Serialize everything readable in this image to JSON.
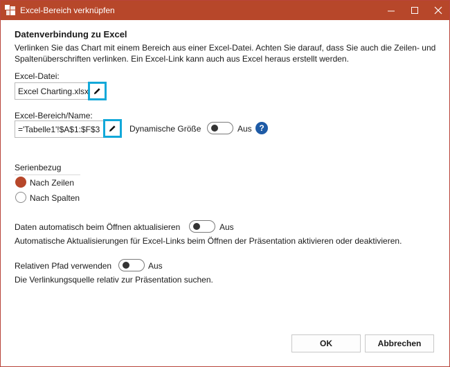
{
  "window": {
    "title": "Excel-Bereich verknüpfen"
  },
  "colors": {
    "titlebar": "#b7472a",
    "accent": "#b7472a",
    "focus_border": "#12a8d9",
    "help": "#1e5ba6"
  },
  "section": {
    "heading": "Datenverbindung zu Excel",
    "description_line1": "Verlinken Sie das Chart mit einem Bereich aus einer Excel-Datei. Achten Sie darauf, dass Sie auch die Zeilen- und",
    "description_line2": "Spaltenüberschriften verlinken. Ein Excel-Link kann auch aus Excel heraus erstellt werden."
  },
  "file": {
    "label": "Excel-Datei:",
    "value": "Excel Charting.xlsx",
    "edit_icon": "pencil-icon"
  },
  "range": {
    "label": "Excel-Bereich/Name:",
    "value": "='Tabelle1'!$A$1:$F$3",
    "edit_icon": "pencil-icon",
    "dynamic_label": "Dynamische Größe",
    "dynamic_state": "Aus",
    "help": "?"
  },
  "series": {
    "label": "Serienbezug",
    "options": [
      {
        "label": "Nach Zeilen",
        "checked": true
      },
      {
        "label": "Nach Spalten",
        "checked": false
      }
    ]
  },
  "auto_update": {
    "label": "Daten automatisch beim Öffnen aktualisieren",
    "state": "Aus",
    "description": "Automatische Aktualisierungen für Excel-Links beim Öffnen der Präsentation aktivieren oder deaktivieren."
  },
  "relative_path": {
    "label": "Relativen Pfad verwenden",
    "state": "Aus",
    "description": "Die Verlinkungsquelle relativ zur Präsentation suchen."
  },
  "buttons": {
    "ok": "OK",
    "cancel": "Abbrechen"
  }
}
